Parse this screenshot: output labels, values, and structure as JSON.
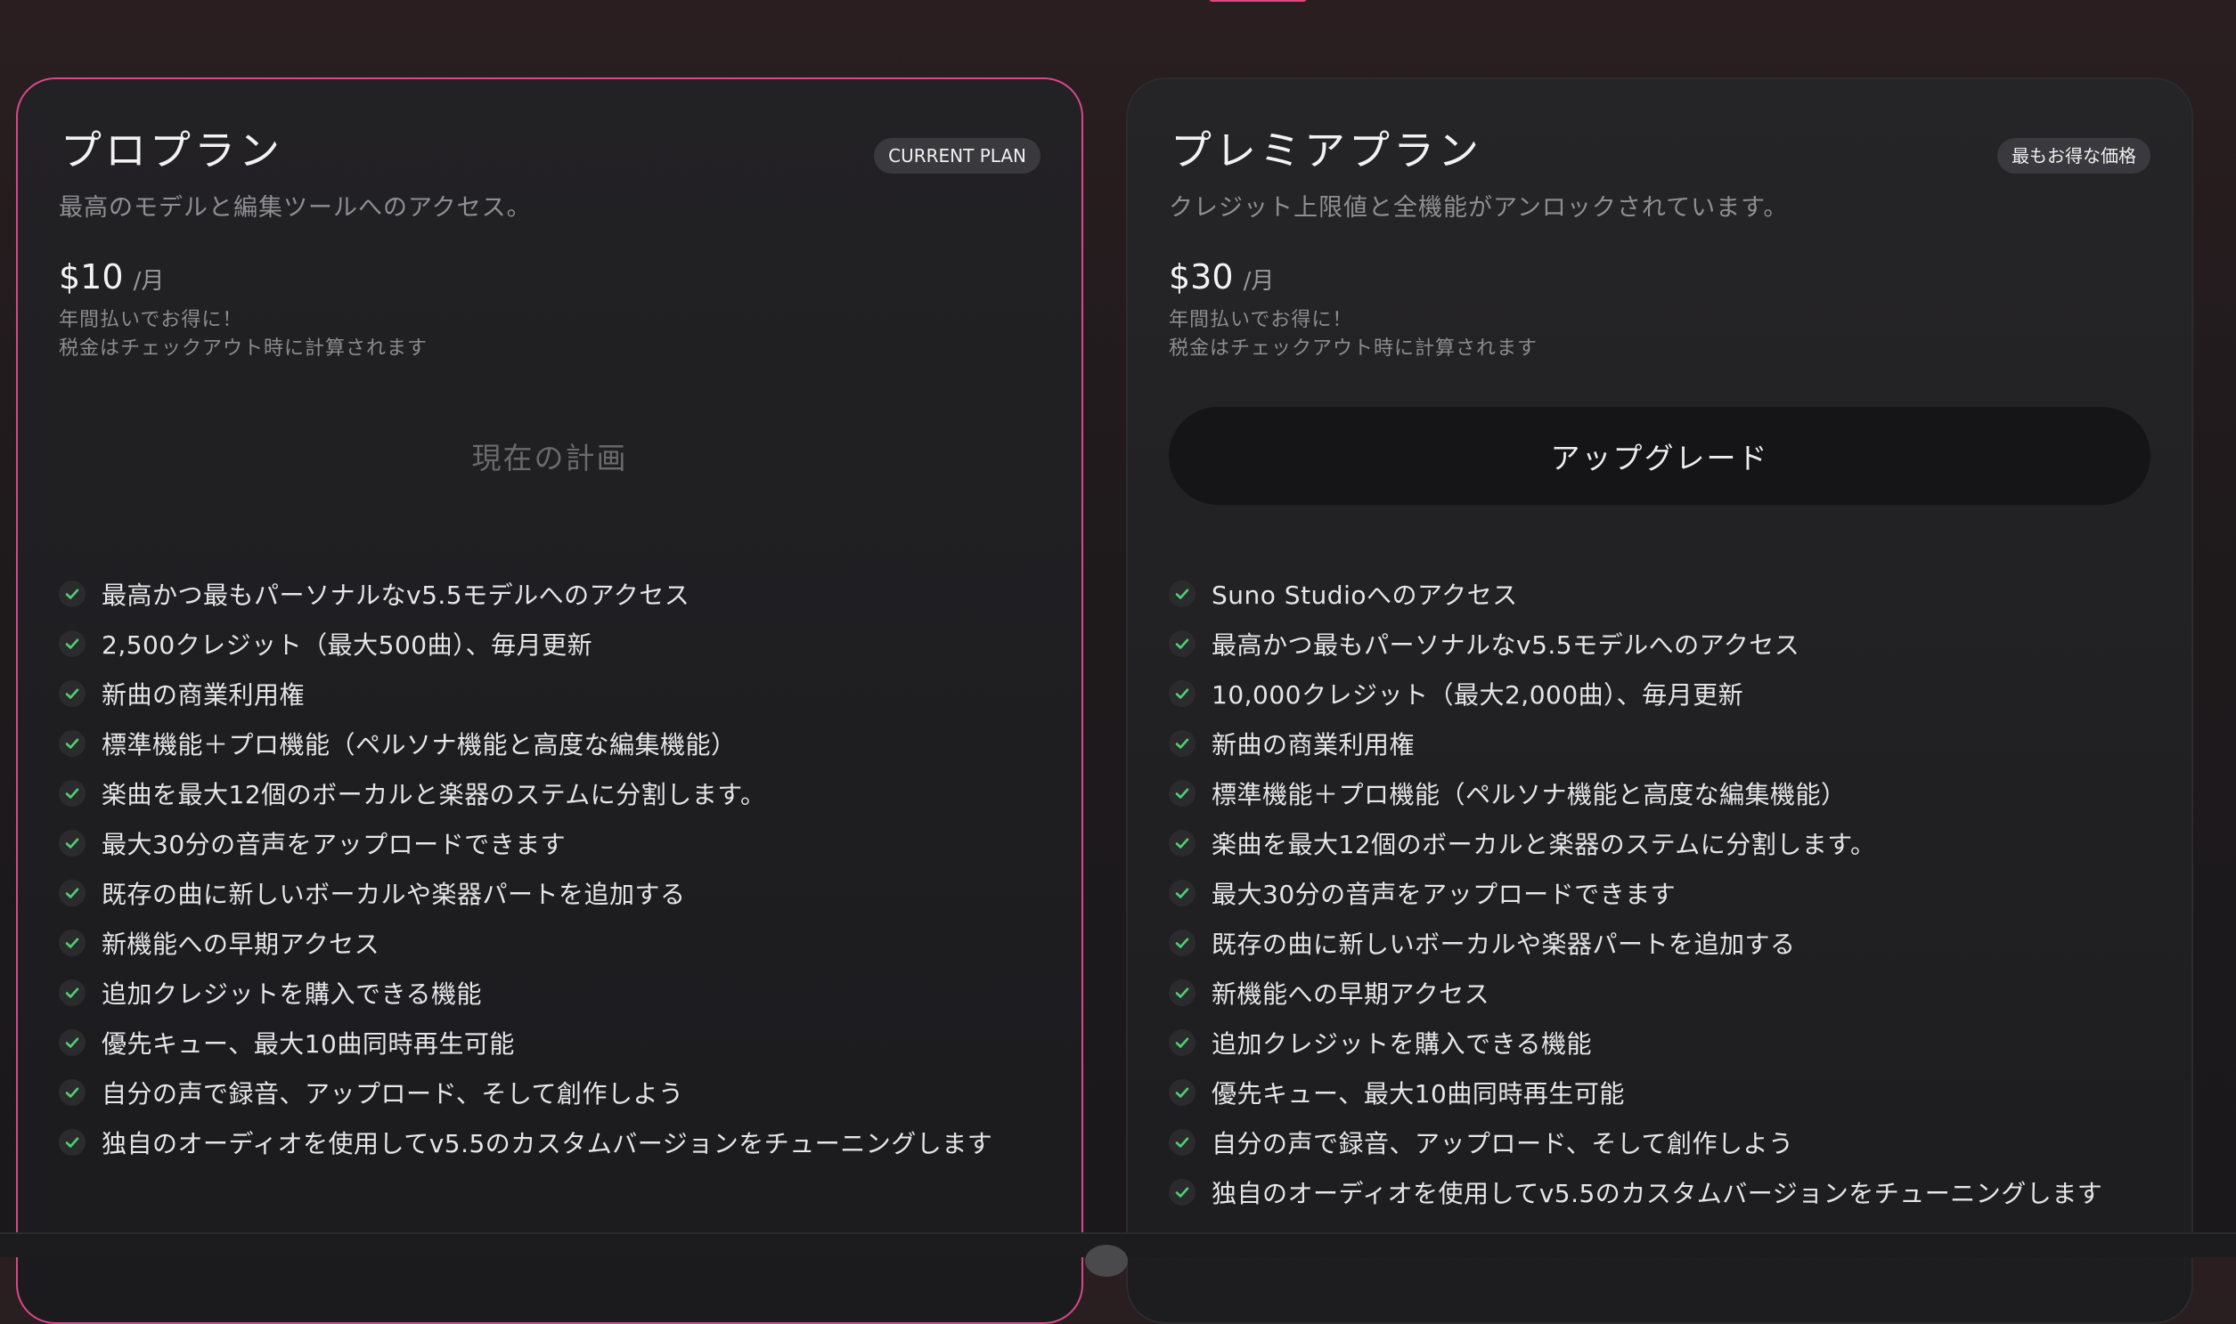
{
  "plans": [
    {
      "title": "プロプラン",
      "badge": "CURRENT PLAN",
      "description": "最高のモデルと編集ツールへのアクセス。",
      "price": "$10",
      "period": "/月",
      "annual_note": "年間払いでお得に！",
      "tax_note": "税金はチェックアウト時に計算されます",
      "cta": "現在の計画",
      "features": [
        "最高かつ最もパーソナルなv5.5モデルへのアクセス",
        "2,500クレジット（最大500曲）、毎月更新",
        "新曲の商業利用権",
        "標準機能＋プロ機能（ペルソナ機能と高度な編集機能）",
        "楽曲を最大12個のボーカルと楽器のステムに分割します。",
        "最大30分の音声をアップロードできます",
        "既存の曲に新しいボーカルや楽器パートを追加する",
        "新機能への早期アクセス",
        "追加クレジットを購入できる機能",
        "優先キュー、最大10曲同時再生可能",
        "自分の声で録音、アップロード、そして創作しよう",
        "独自のオーディオを使用してv5.5のカスタムバージョンをチューニングします"
      ]
    },
    {
      "title": "プレミアプラン",
      "badge": "最もお得な価格",
      "description": "クレジット上限値と全機能がアンロックされています。",
      "price": "$30",
      "period": "/月",
      "annual_note": "年間払いでお得に！",
      "tax_note": "税金はチェックアウト時に計算されます",
      "cta": "アップグレード",
      "features": [
        "Suno Studioへのアクセス",
        "最高かつ最もパーソナルなv5.5モデルへのアクセス",
        "10,000クレジット（最大2,000曲）、毎月更新",
        "新曲の商業利用権",
        "標準機能＋プロ機能（ペルソナ機能と高度な編集機能）",
        "楽曲を最大12個のボーカルと楽器のステムに分割します。",
        "最大30分の音声をアップロードできます",
        "既存の曲に新しいボーカルや楽器パートを追加する",
        "新機能への早期アクセス",
        "追加クレジットを購入できる機能",
        "優先キュー、最大10曲同時再生可能",
        "自分の声で録音、アップロード、そして創作しよう",
        "独自のオーディオを使用してv5.5のカスタムバージョンをチューニングします"
      ]
    }
  ],
  "icons": {
    "feature": "check-icon"
  },
  "colors": {
    "accent": "#d9488a",
    "check": "#4fcf73"
  }
}
